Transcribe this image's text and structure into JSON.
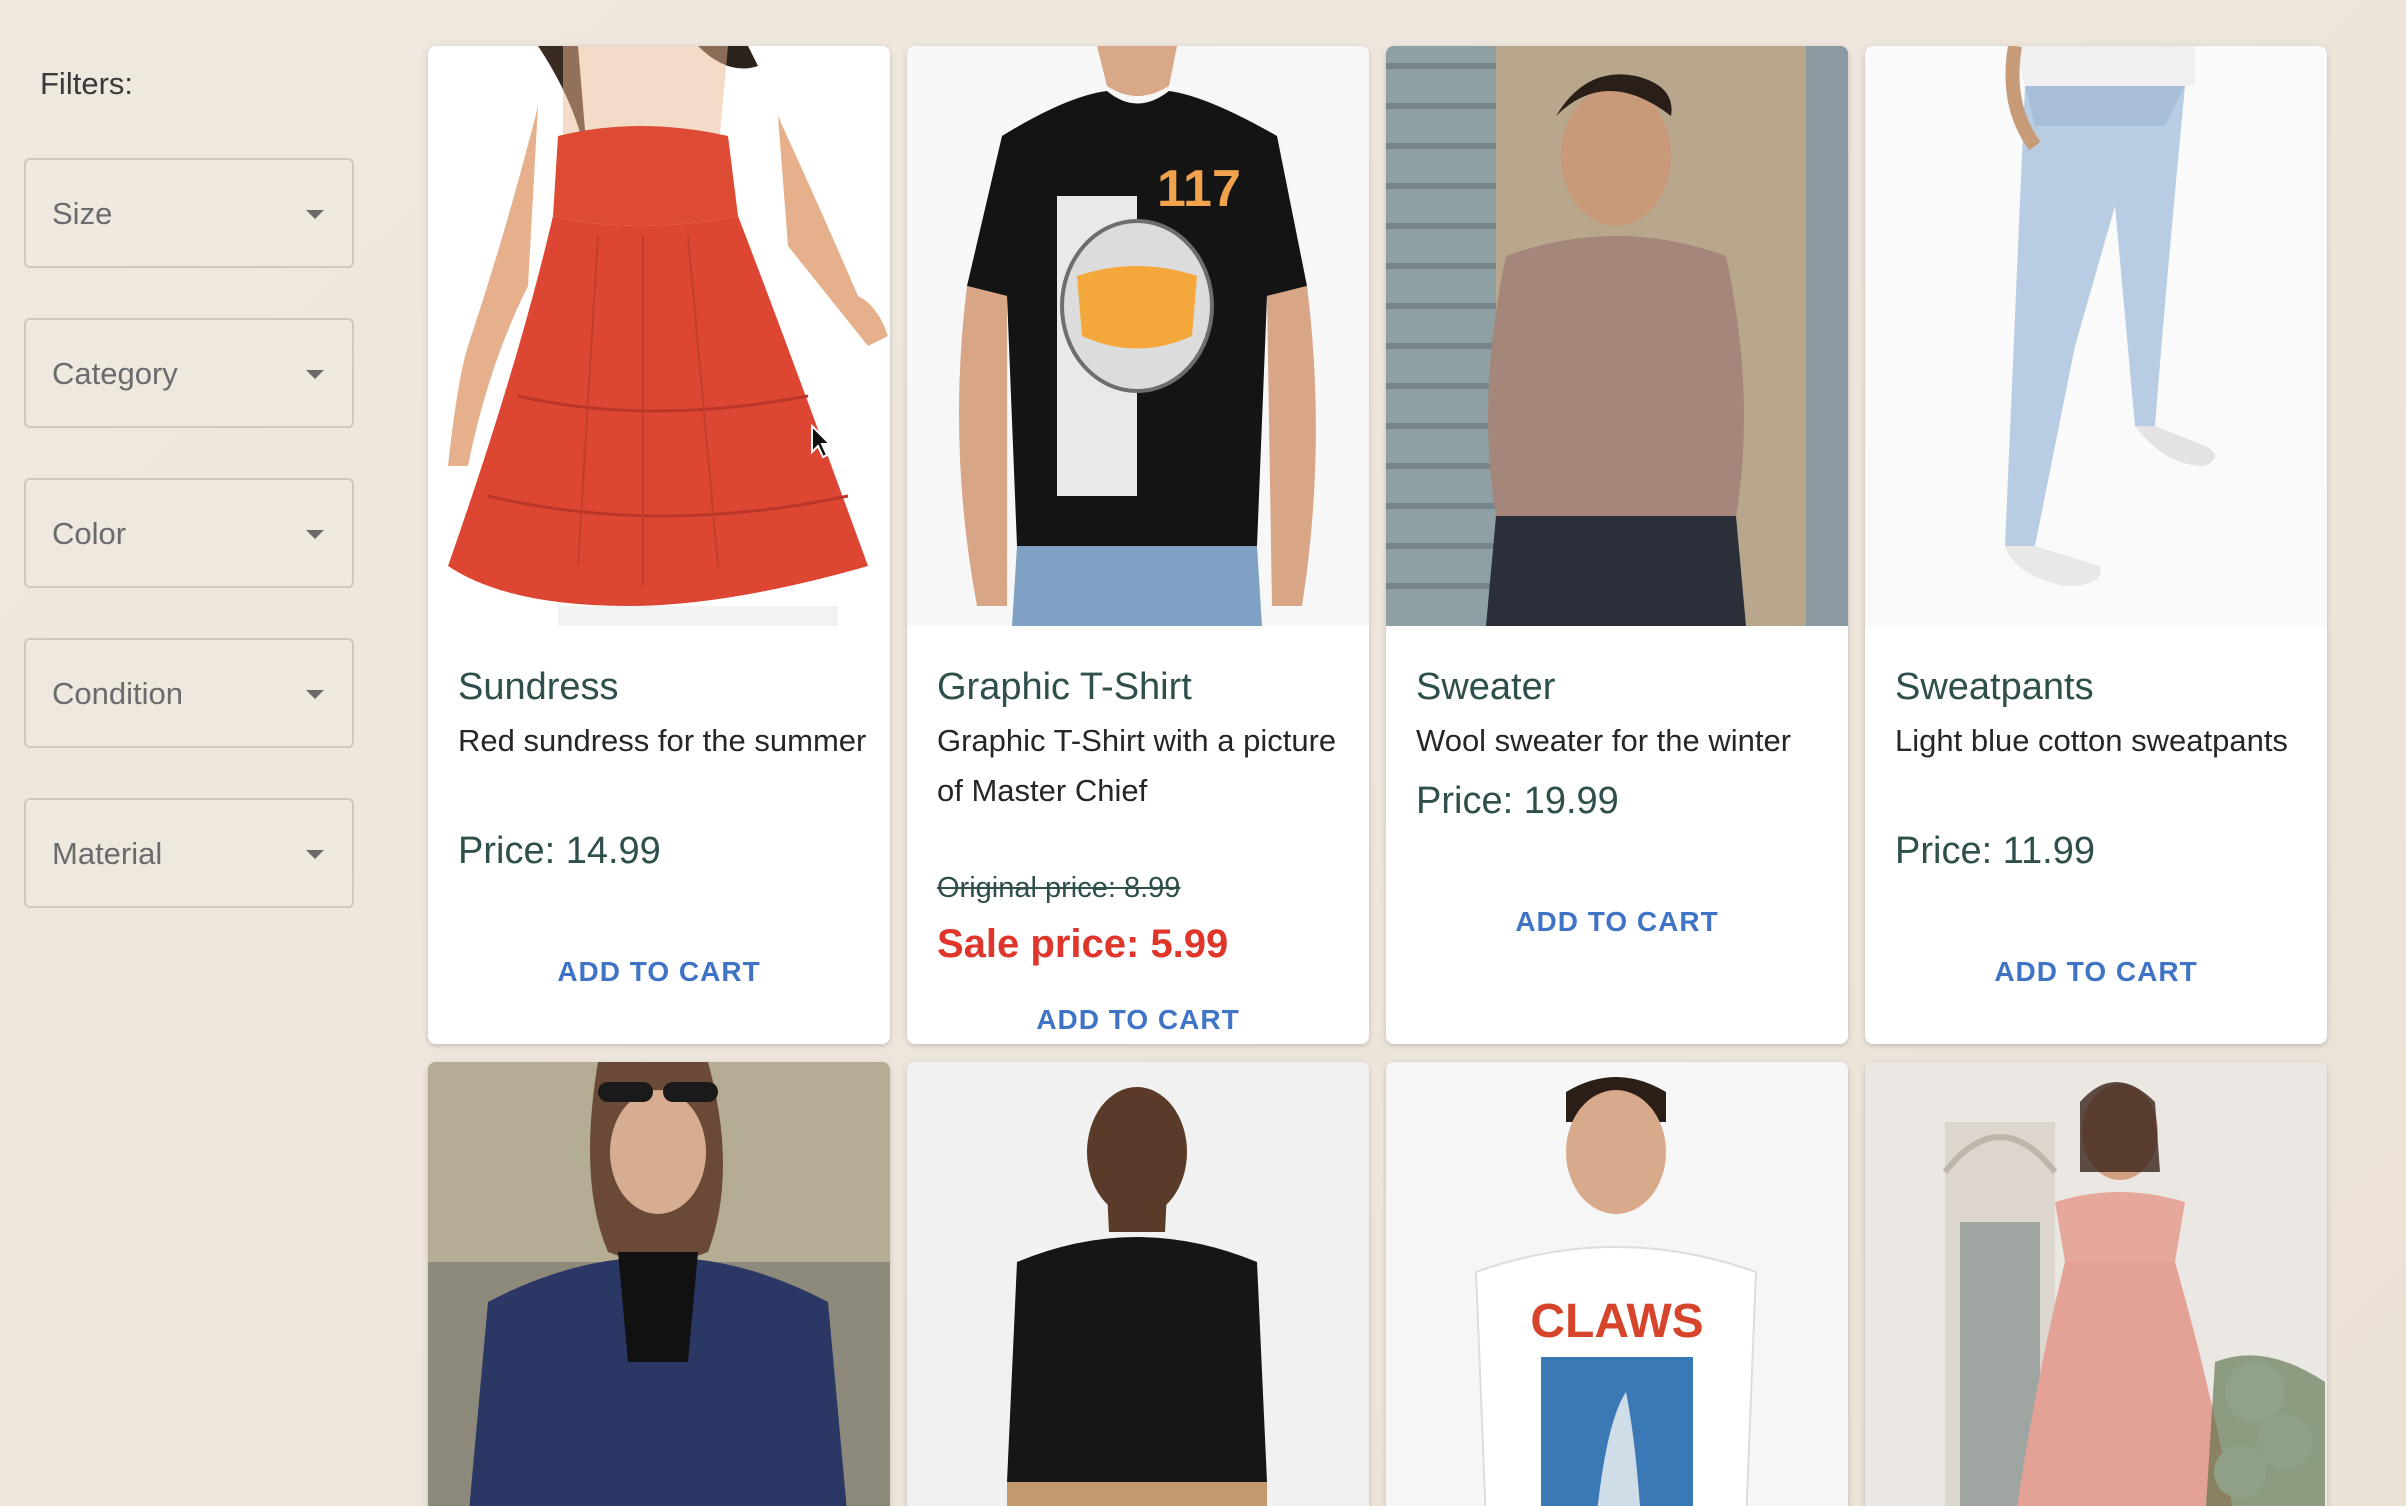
{
  "filters": {
    "title": "Filters:",
    "items": [
      {
        "label": "Size"
      },
      {
        "label": "Category"
      },
      {
        "label": "Color"
      },
      {
        "label": "Condition"
      },
      {
        "label": "Material"
      }
    ]
  },
  "products": [
    {
      "title": "Sundress",
      "desc": "Red sundress for the summer",
      "price": "Price: 14.99",
      "cart": "ADD TO CART"
    },
    {
      "title": "Graphic T-Shirt",
      "desc": "Graphic T-Shirt with a picture of Master Chief",
      "original_price": "Original price: 8.99",
      "sale_price": "Sale price: 5.99",
      "cart": "ADD TO CART",
      "shirt_print": "117"
    },
    {
      "title": "Sweater",
      "desc": "Wool sweater for the winter",
      "price": "Price: 19.99",
      "cart": "ADD TO CART"
    },
    {
      "title": "Sweatpants",
      "desc": "Light blue cotton sweatpants",
      "price": "Price: 11.99",
      "cart": "ADD TO CART"
    }
  ],
  "row2": {
    "claws_print": "CLAWS"
  },
  "icons": {
    "dropdown": "chevron-down-icon",
    "cursor": "mouse-pointer-icon"
  },
  "colors": {
    "title": "#2e4f4b",
    "sale": "#e0352b",
    "cart": "#3f73c6"
  }
}
